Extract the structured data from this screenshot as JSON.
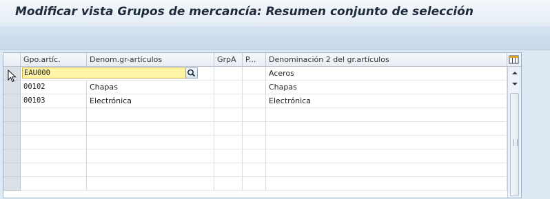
{
  "title": "Modificar vista Grupos de mercancía: Resumen conjunto de selección",
  "table": {
    "columns": [
      "Gpo.artíc.",
      "Denom.gr-artículos",
      "GrpA",
      "P...",
      "Denominación 2 del gr.artículos"
    ],
    "rows": [
      {
        "code": "EAU000",
        "name": "",
        "grpa": "",
        "p": "",
        "name2": "Aceros"
      },
      {
        "code": "00102",
        "name": "Chapas",
        "grpa": "",
        "p": "",
        "name2": "Chapas"
      },
      {
        "code": "00103",
        "name": "Electrónica",
        "grpa": "",
        "p": "",
        "name2": "Electrónica"
      }
    ],
    "empty_rows": 6
  },
  "icons": {
    "search_help": "magnifier-icon",
    "column_config": "table-settings-icon",
    "cursor": "mouse-pointer-icon",
    "scroll_up": "triangle-up-icon",
    "scroll_down": "triangle-down-icon"
  },
  "colors": {
    "input_highlight": "#fff3a6",
    "title_text": "#1d2a3a",
    "background": "#dfe9f4"
  }
}
